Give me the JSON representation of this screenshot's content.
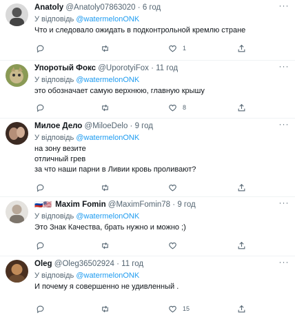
{
  "reply_prefix": "У відповідь",
  "tweets": [
    {
      "name": "Anatoly",
      "flags": "",
      "handle": "@Anatoly07863020",
      "dot": "·",
      "time": "6 год",
      "reply_to": "@watermelonONK",
      "lines": [
        "Что и следовало ожидать в подконтрольной кремлю стране"
      ],
      "likes": "1",
      "avatar_colors": [
        "#5c5c5c",
        "#c9c9c9"
      ]
    },
    {
      "name": "Упоротый Фокс",
      "flags": "",
      "handle": "@UporotyiFox",
      "dot": "·",
      "time": "11 год",
      "reply_to": "@watermelonONK",
      "lines": [
        "это обозначает самую верхнюю, главную крышу"
      ],
      "likes": "8",
      "avatar_colors": [
        "#6e7a44",
        "#c3b78a"
      ]
    },
    {
      "name": "Милое Дело",
      "flags": "",
      "handle": "@MiloeDelo",
      "dot": "·",
      "time": "9 год",
      "reply_to": "@watermelonONK",
      "lines": [
        "на зону везите",
        "отличный грев",
        "за что наши парни в Ливии кровь проливают?"
      ],
      "likes": "",
      "avatar_colors": [
        "#3b2a22",
        "#b58f78"
      ]
    },
    {
      "name": "Maxim Fomin",
      "flags": "🇷🇺🇺🇸",
      "handle": "@MaximFomin78",
      "dot": "·",
      "time": "9 год",
      "reply_to": "@watermelonONK",
      "lines": [
        "Это Знак Качества, брать нужно и можно ;)"
      ],
      "likes": "",
      "avatar_colors": [
        "#d8d6d2",
        "#9a9086"
      ]
    },
    {
      "name": "Oleg",
      "flags": "",
      "handle": "@Oleg36502924",
      "dot": "·",
      "time": "11 год",
      "reply_to": "@watermelonONK",
      "lines": [
        "И почему я совершенно не удивленный ."
      ],
      "likes": "15",
      "avatar_colors": [
        "#4a3020",
        "#c08a58"
      ]
    }
  ]
}
